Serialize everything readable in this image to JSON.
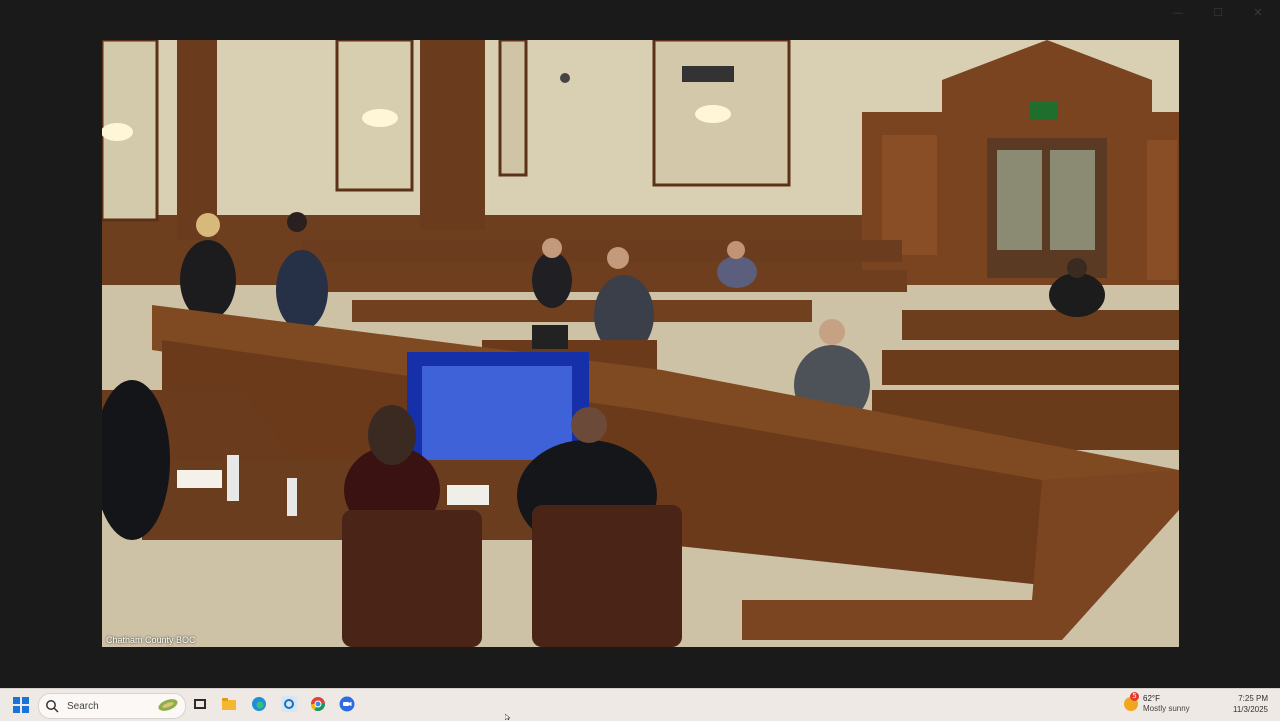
{
  "window": {
    "controls": {
      "minimize": "—",
      "maximize": "☐",
      "close": "✕"
    }
  },
  "video": {
    "caption": "Chatham County BOC",
    "exit_sign": "EXIT"
  },
  "taskbar": {
    "search_label": "Search",
    "apps": [
      "start-icon",
      "task-view-icon",
      "file-explorer-icon",
      "edge-icon",
      "snipping-tool-icon",
      "chrome-icon",
      "zoom-icon"
    ],
    "weather": {
      "badge": "5",
      "temperature": "62°F",
      "condition": "Mostly sunny"
    },
    "clock": {
      "time": "7:25 PM",
      "date": "11/3/2025"
    }
  },
  "colors": {
    "wall": "#d9d0b3",
    "wood": "#7a4a26",
    "taskbar": "#efe9e5",
    "windows_blue": "#1a73d9"
  }
}
